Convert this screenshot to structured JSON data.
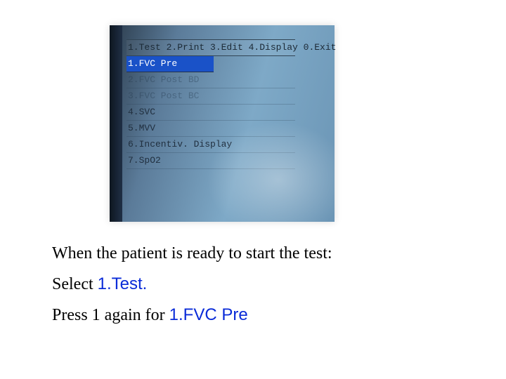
{
  "screen": {
    "menu_header": "1.Test 2.Print 3.Edit 4.Display 0.Exit",
    "items": [
      "1.FVC Pre",
      "2.FVC Post BD",
      "3.FVC Post BC",
      "4.SVC",
      "5.MVV",
      "6.Incentiv. Display",
      "7.SpO2"
    ],
    "selected_index": 0,
    "muted_indices": [
      1,
      2
    ]
  },
  "caption": {
    "line1": "When the patient is ready to start the test:",
    "line2_plain": "Select ",
    "line2_hl": "1.Test.",
    "line3_plain": "Press 1 again for ",
    "line3_hl": "1.FVC Pre"
  }
}
